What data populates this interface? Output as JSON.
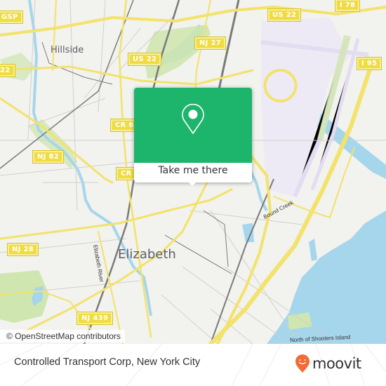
{
  "map": {
    "attribution": "© OpenStreetMap contributors",
    "colors": {
      "background": "#f2f2ee",
      "water": "#a5d6ec",
      "park": "#cfe6b0",
      "road_major": "#f3e26b",
      "road_minor": "#d0d0cc",
      "railway": "#7a7a7a",
      "airport": "#e3dcf2"
    },
    "shields": [
      {
        "id": "gsp",
        "label": "GSP"
      },
      {
        "id": "us22-left",
        "label": "22"
      },
      {
        "id": "us22-mid",
        "label": "US 22"
      },
      {
        "id": "nj27",
        "label": "NJ 27"
      },
      {
        "id": "us22-right",
        "label": "US 22"
      },
      {
        "id": "i78",
        "label": "I 78"
      },
      {
        "id": "i95",
        "label": "I 95"
      },
      {
        "id": "cr6",
        "label": "CR 6"
      },
      {
        "id": "nj82",
        "label": "NJ 82"
      },
      {
        "id": "cr",
        "label": "CR"
      },
      {
        "id": "nj28",
        "label": "NJ 28"
      },
      {
        "id": "nj439",
        "label": "NJ 439"
      }
    ],
    "places": {
      "hillside": "Hillside",
      "elizabeth": "Elizabeth",
      "elizabeth_river": "Elizabeth River",
      "bound_creek": "Bound Creek",
      "shooters_island": "North of Shooters Island"
    }
  },
  "popup": {
    "icon": "location-pin-icon",
    "button_label": "Take me there",
    "accent_color": "#1db56b"
  },
  "footer": {
    "title": "Controlled Transport Corp, New York City",
    "brand": "moovit",
    "brand_color": "#f26a36"
  }
}
